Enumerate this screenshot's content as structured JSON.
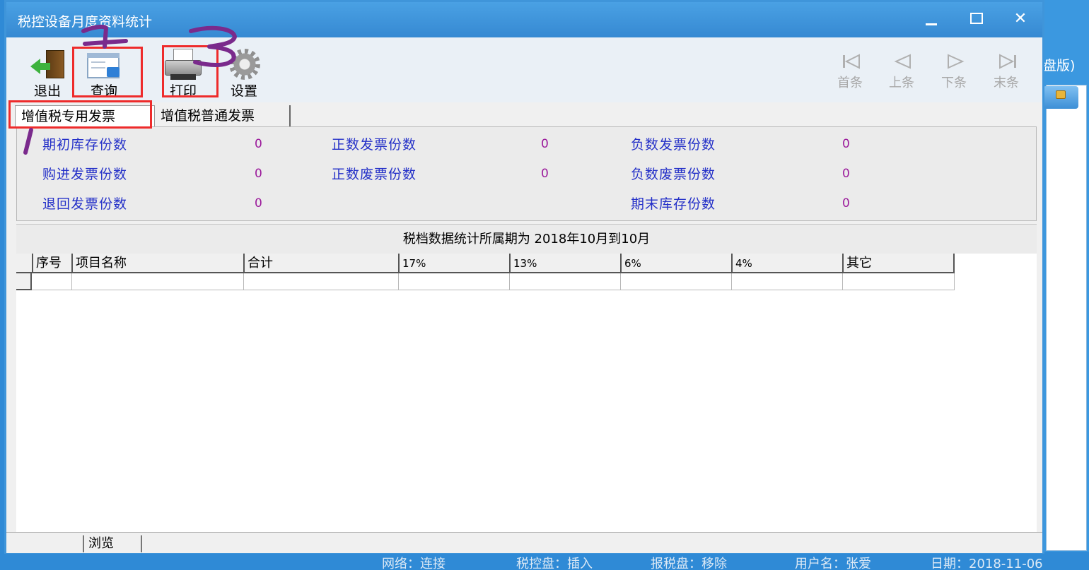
{
  "background_app": {
    "title_fragment": "盘版)",
    "status_bar": {
      "network": "网络：连接",
      "tax_control_disk": "税控盘：插入",
      "tax_report_disk": "报税盘：移除",
      "username": "用户名：张爱",
      "date": "日期：2018-11-06"
    }
  },
  "dialog": {
    "title": "税控设备月度资料统计",
    "window_buttons": {
      "close": "✕"
    },
    "toolbar": {
      "exit": "退出",
      "query": "查询",
      "print": "打印",
      "settings": "设置",
      "nav_first": "首条",
      "nav_prev": "上条",
      "nav_next": "下条",
      "nav_last": "末条"
    },
    "tabs": {
      "special": "增值税专用发票",
      "general": "增值税普通发票"
    },
    "summary": {
      "opening_stock_label": "期初库存份数",
      "opening_stock_value": "0",
      "purchased_label": "购进发票份数",
      "purchased_value": "0",
      "returned_label": "退回发票份数",
      "returned_value": "0",
      "positive_issued_label": "正数发票份数",
      "positive_issued_value": "0",
      "positive_void_label": "正数废票份数",
      "positive_void_value": "0",
      "negative_issued_label": "负数发票份数",
      "negative_issued_value": "0",
      "negative_void_label": "负数废票份数",
      "negative_void_value": "0",
      "closing_stock_label": "期末库存份数",
      "closing_stock_value": "0"
    },
    "period_text": "税档数据统计所属期为 2018年10月到10月",
    "grid": {
      "columns": [
        "序号",
        "项目名称",
        "合计",
        "17%",
        "13%",
        "6%",
        "4%",
        "其它"
      ]
    },
    "status": {
      "mode": "浏览"
    }
  },
  "annotations": {
    "color": "#ee2b2b",
    "pen_color": "#7a2a8c",
    "numbers": [
      "1",
      "2",
      "3"
    ]
  }
}
